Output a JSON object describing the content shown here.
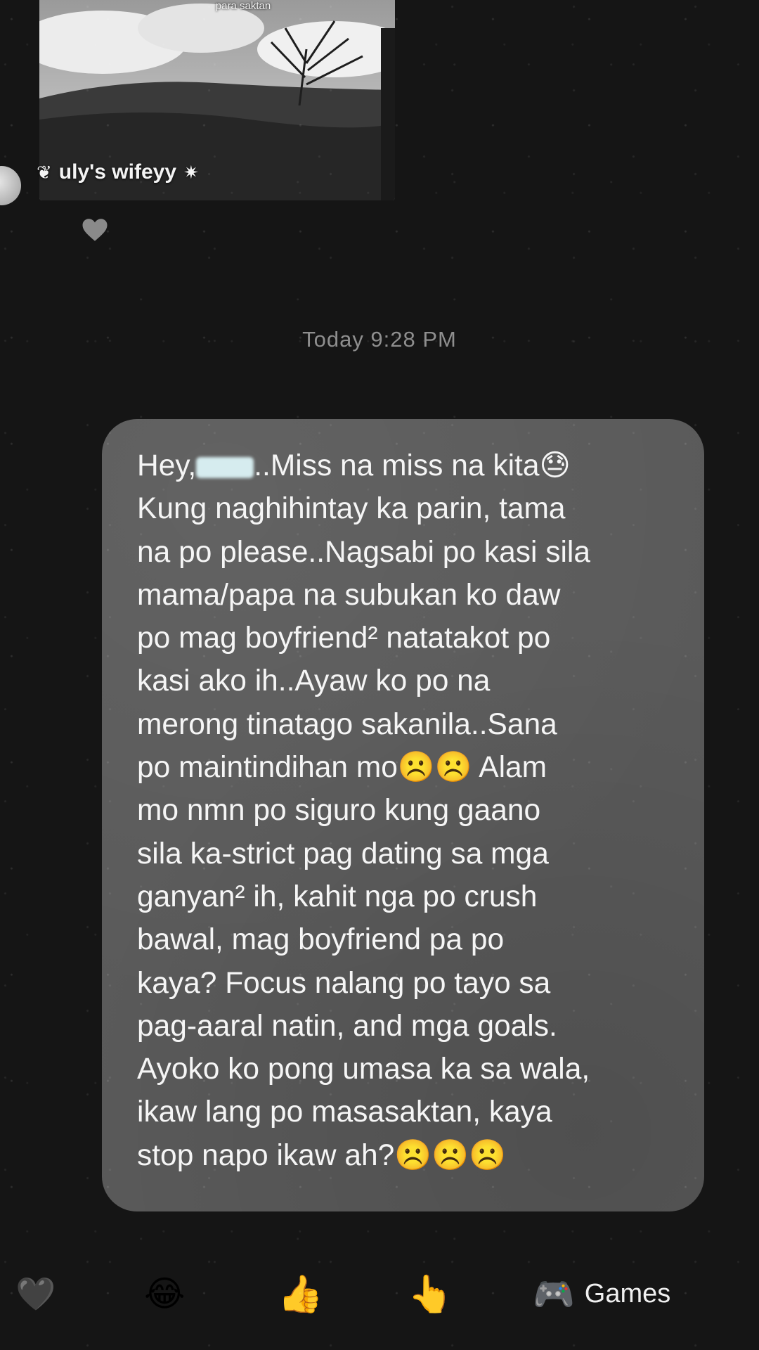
{
  "shared_post": {
    "caption": "para saktan",
    "author": "uly's wifeyy",
    "author_prefix_glyph": "❦",
    "author_suffix_glyph": "✷"
  },
  "reaction": {
    "icon": "heart-icon",
    "color": "#8a8a8a"
  },
  "timestamp": "Today 9:28 PM",
  "message": {
    "greeting": "Hey,",
    "body": "..Miss na miss na kita😓\nKung naghihintay ka parin, tama\nna po please..Nagsabi po kasi sila\nmama/papa na subukan ko daw\npo mag boyfriend² natatakot po\nkasi ako ih..Ayaw ko po na\nmerong tinatago sakanila..Sana\npo maintindihan mo☹️☹️ Alam\nmo nmn po siguro kung gaano\nsila ka-strict pag dating sa mga\nganyan² ih, kahit nga po crush\nbawal, mag boyfriend pa po\nkaya? Focus nalang po tayo sa\npag-aaral natin, and mga goals.\nAyoko ko pong umasa ka sa wala,\nikaw lang po masasaktan, kaya\nstop napo ikaw ah?☹️☹️☹️",
    "bubble_color": "#5a5a5a"
  },
  "quick_reactions": {
    "heart": "🖤",
    "laugh": "😂",
    "thumbs_up": "👍",
    "poke": "👆",
    "games_icon": "🎮",
    "games_label": "Games"
  }
}
